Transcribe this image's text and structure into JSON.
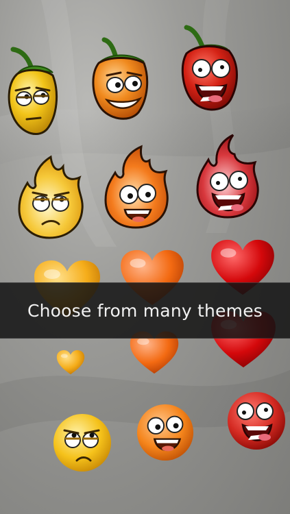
{
  "banner": {
    "caption": "Choose from many themes"
  },
  "themes": {
    "peppers": [
      {
        "icon": "yellow-pepper-bored-icon",
        "color": "#f2c419"
      },
      {
        "icon": "orange-pepper-grin-icon",
        "color": "#f08a1e"
      },
      {
        "icon": "red-pepper-scream-icon",
        "color": "#d42215"
      }
    ],
    "flames": [
      {
        "icon": "yellow-flame-annoyed-icon",
        "color": "#f6c93a"
      },
      {
        "icon": "orange-flame-happy-icon",
        "color": "#f47b1d"
      },
      {
        "icon": "red-flame-scream-icon",
        "color": "#d8383d"
      }
    ],
    "hearts": [
      {
        "icon": "yellow-heart-icon",
        "color": "#f5ad1a"
      },
      {
        "icon": "orange-heart-icon",
        "color": "#f36a12"
      },
      {
        "icon": "red-heart-icon",
        "color": "#d4080b"
      }
    ],
    "faces": [
      {
        "icon": "yellow-face-rolling-eyes-icon",
        "color": "#f5c21b"
      },
      {
        "icon": "orange-face-happy-icon",
        "color": "#f5851c"
      },
      {
        "icon": "red-face-scream-icon",
        "color": "#d42a22"
      }
    ]
  }
}
